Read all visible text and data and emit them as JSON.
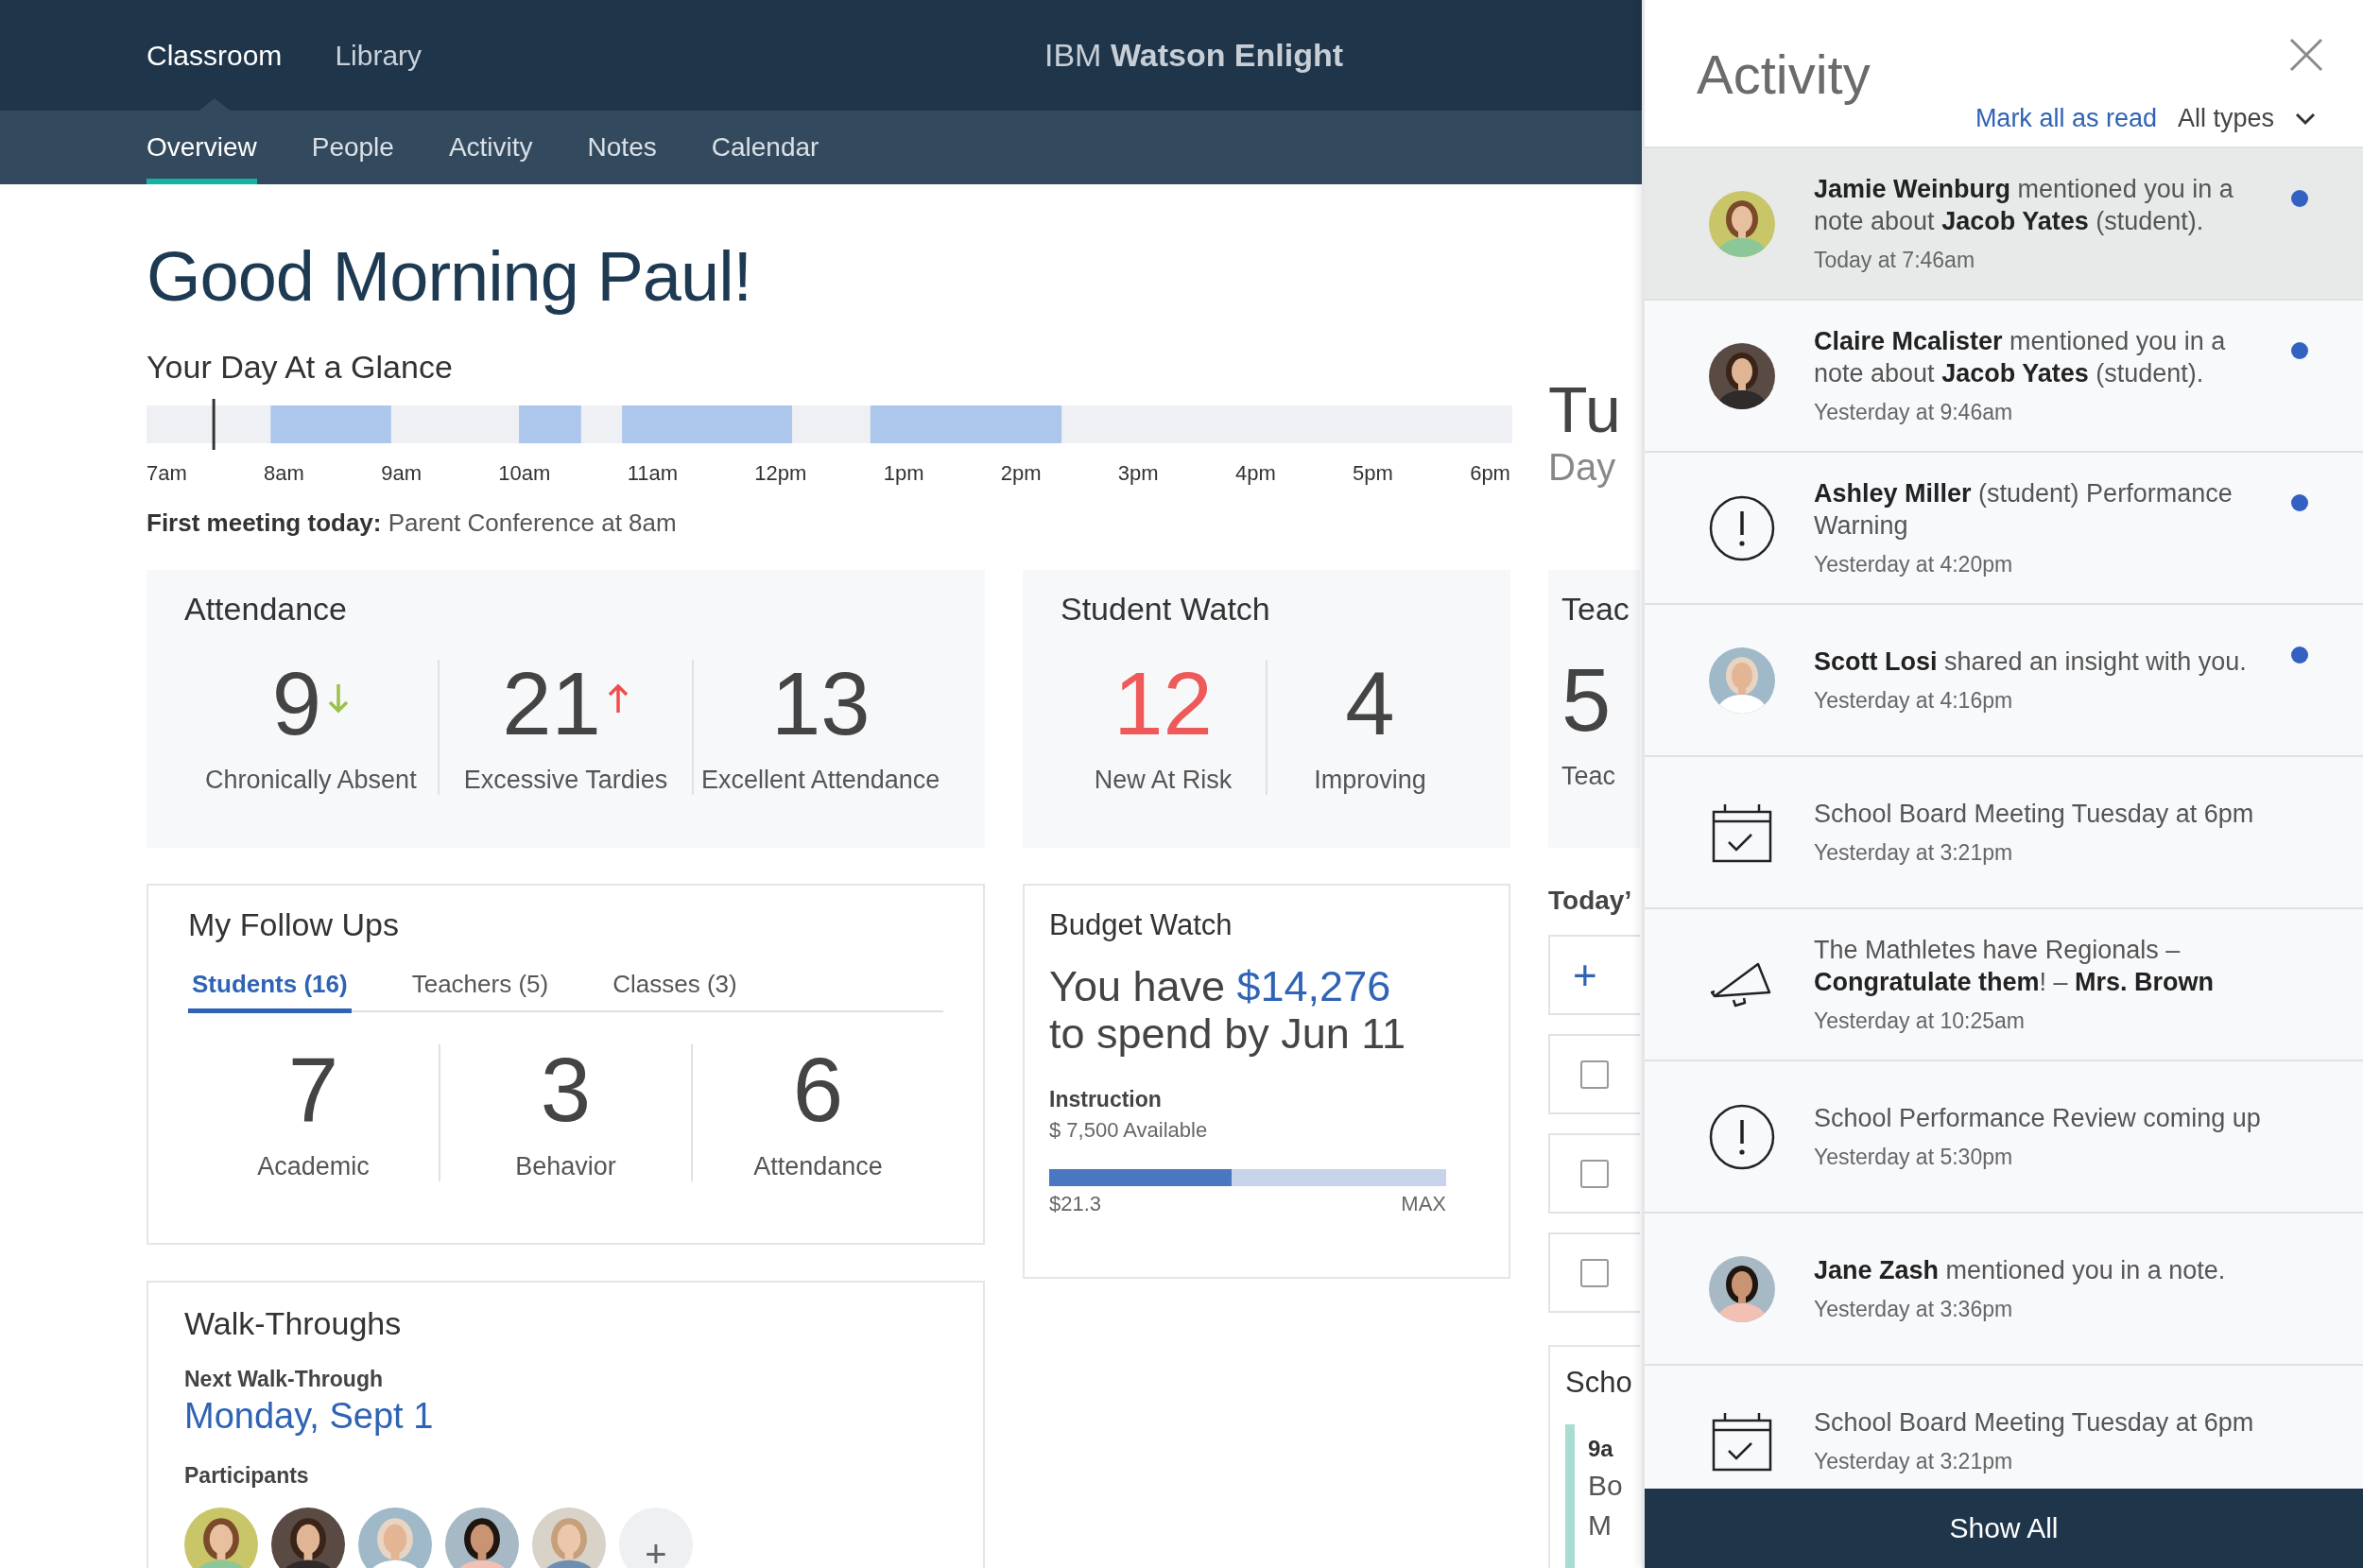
{
  "header": {
    "primary_nav": [
      {
        "label": "Classroom",
        "selected": true
      },
      {
        "label": "Library",
        "selected": false
      }
    ],
    "brand": "IBM **Watson Enlight**",
    "secondary_nav": [
      {
        "label": "Overview",
        "selected": true
      },
      {
        "label": "People",
        "selected": false
      },
      {
        "label": "Activity",
        "selected": false
      },
      {
        "label": "Notes",
        "selected": false
      },
      {
        "label": "Calendar",
        "selected": false
      }
    ]
  },
  "greeting": "Good Morning Paul!",
  "glance": {
    "title": "Your Day At a Glance",
    "hours": [
      "7am",
      "8am",
      "9am",
      "10am",
      "11am",
      "12pm",
      "1pm",
      "2pm",
      "3pm",
      "4pm",
      "5pm",
      "6pm"
    ],
    "first_meeting": "**First meeting today:** Parent Conference at 8am"
  },
  "date": {
    "day": "Tu",
    "sub": "Day"
  },
  "attendance": {
    "title": "Attendance",
    "stats": [
      {
        "value": "9",
        "label": "Chronically Absent",
        "kind": "falling"
      },
      {
        "value": "21",
        "label": "Excessive Tardies",
        "kind": "rising"
      },
      {
        "value": "13",
        "label": "Excellent Attendance",
        "kind": "plain"
      }
    ]
  },
  "student_watch": {
    "title": "Student Watch",
    "stats": [
      {
        "value": "12",
        "label": "New At Risk",
        "kind": "alert"
      },
      {
        "value": "4",
        "label": "Improving",
        "kind": "plain"
      }
    ]
  },
  "teachers": {
    "title": "Teac",
    "value": "5",
    "label": "Teac"
  },
  "follow_ups": {
    "title": "My Follow Ups",
    "tabs": [
      {
        "label": "Students (16)",
        "selected": true
      },
      {
        "label": "Teachers (5)",
        "selected": false
      },
      {
        "label": "Classes (3)",
        "selected": false
      }
    ],
    "stats": [
      {
        "value": "7",
        "label": "Academic"
      },
      {
        "value": "3",
        "label": "Behavior"
      },
      {
        "value": "6",
        "label": "Attendance"
      }
    ]
  },
  "budget": {
    "title": "Budget Watch",
    "lead": "You have",
    "amount": "$14,276",
    "deadline": "to spend by Jun 11",
    "category": "Instruction",
    "available": "$ 7,500 Available",
    "level": 0.46,
    "min_label": "$21.3",
    "max_label": "MAX"
  },
  "walk_throughs": {
    "title": "Walk-Throughs",
    "next_label": "Next Walk-Through",
    "next_date": "Monday, Sept 1",
    "participants_label": "Participants",
    "add_label": "+"
  },
  "todays": {
    "title": "Today’",
    "add_label": "+",
    "tasks": [
      {
        "checked": false
      },
      {
        "checked": false
      },
      {
        "checked": false
      }
    ]
  },
  "schedule": {
    "title": "Scho",
    "time": "9a",
    "lines": [
      "Bo",
      "M"
    ]
  },
  "activity": {
    "title": "Activity",
    "mark_all": "Mark all as read",
    "filter": "All types",
    "items": [
      {
        "kind": "avatar",
        "text": "**Jamie Weinburg** mentioned you in a note about **Jacob Yates** (student).",
        "time": "Today at 7:46am",
        "unread": true,
        "selected": true
      },
      {
        "kind": "avatar",
        "text": "**Claire Mcalister** mentioned you in a note about **Jacob Yates** (student).",
        "time": "Yesterday at 9:46am",
        "unread": true,
        "selected": false
      },
      {
        "kind": "alert",
        "text": "**Ashley Miller** (student) Performance Warning",
        "time": "Yesterday at 4:20pm",
        "unread": true,
        "selected": false
      },
      {
        "kind": "avatar",
        "text": "**Scott Losi** shared an insight with you.",
        "time": "Yesterday at 4:16pm",
        "unread": true,
        "selected": false
      },
      {
        "kind": "calendar",
        "text": "School Board Meeting Tuesday at 6pm",
        "time": "Yesterday at 3:21pm",
        "unread": false,
        "selected": false
      },
      {
        "kind": "megaphone",
        "text": "The Mathletes have Regionals – **Congratulate them**! – **Mrs. Brown**",
        "time": "Yesterday at 10:25am",
        "unread": false,
        "selected": false
      },
      {
        "kind": "alert",
        "text": "School Performance Review coming up",
        "time": "Yesterday at 5:30pm",
        "unread": false,
        "selected": false
      },
      {
        "kind": "avatar",
        "text": "**Jane Zash** mentioned you in a note.",
        "time": "Yesterday at 3:36pm",
        "unread": false,
        "selected": false
      },
      {
        "kind": "calendar",
        "text": "School Board Meeting Tuesday at 6pm",
        "time": "Yesterday at 3:21pm",
        "unread": false,
        "selected": false
      }
    ],
    "show_all": "Show All"
  }
}
